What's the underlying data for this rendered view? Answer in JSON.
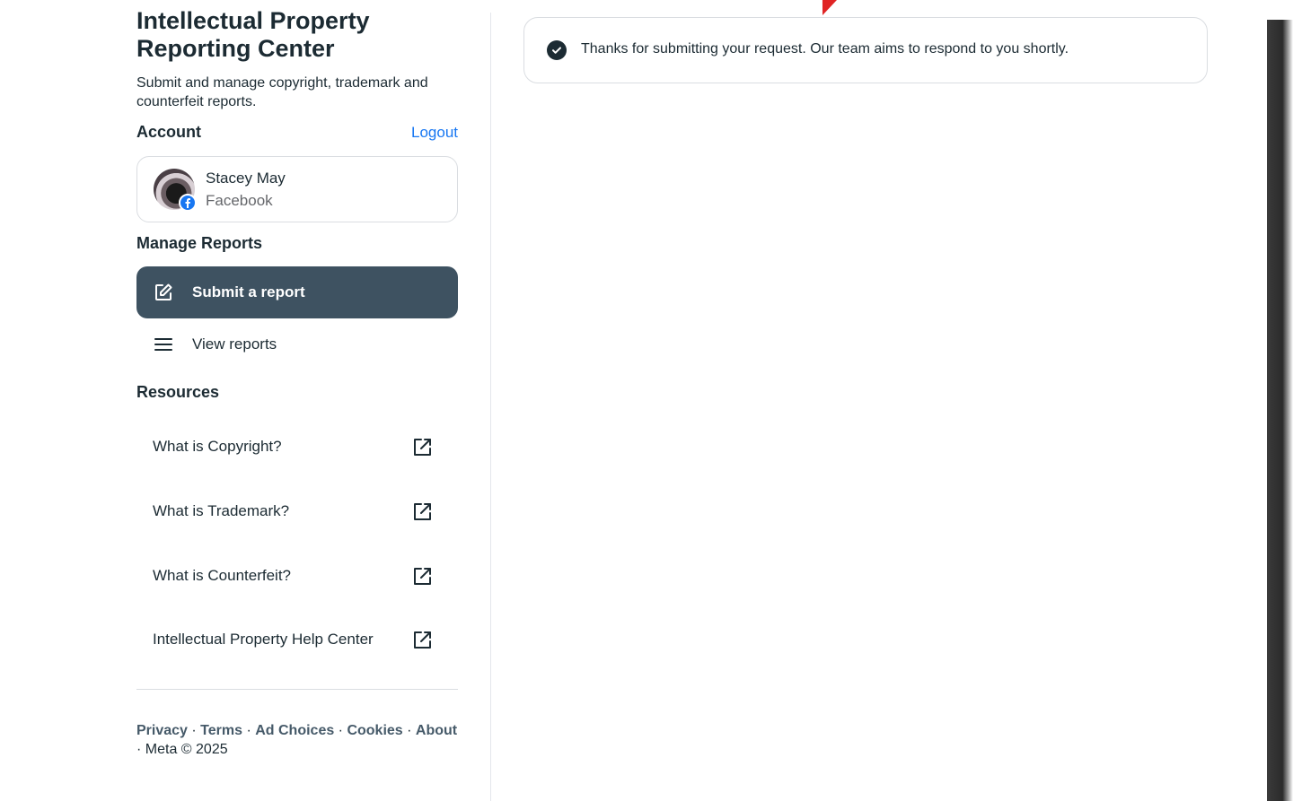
{
  "header": {
    "title": "Intellectual Property Reporting Center",
    "subtitle": "Submit and manage copyright, trademark and counterfeit reports."
  },
  "account": {
    "heading": "Account",
    "logout_label": "Logout",
    "name": "Stacey May",
    "platform": "Facebook"
  },
  "manage_reports": {
    "heading": "Manage Reports",
    "items": [
      {
        "label": "Submit a report",
        "icon": "edit-icon",
        "active": true
      },
      {
        "label": "View reports",
        "icon": "menu-icon",
        "active": false
      }
    ]
  },
  "resources": {
    "heading": "Resources",
    "items": [
      {
        "label": "What is Copyright?",
        "icon": "external-link-icon"
      },
      {
        "label": "What is Trademark?",
        "icon": "external-link-icon"
      },
      {
        "label": "What is Counterfeit?",
        "icon": "external-link-icon"
      },
      {
        "label": "Intellectual Property Help Center",
        "icon": "external-link-icon"
      }
    ]
  },
  "footer": {
    "links": [
      "Privacy",
      "Terms",
      "Ad Choices",
      "Cookies",
      "About"
    ],
    "separator": " · ",
    "copyright": "· Meta © 2025"
  },
  "banner": {
    "message": "Thanks for submitting your request. Our team aims to respond to you shortly.",
    "icon": "check-circle-icon"
  },
  "colors": {
    "accent": "#1877f2",
    "nav_active_bg": "#3e5261",
    "text_primary": "#1c2b33",
    "text_secondary": "#65676b"
  }
}
